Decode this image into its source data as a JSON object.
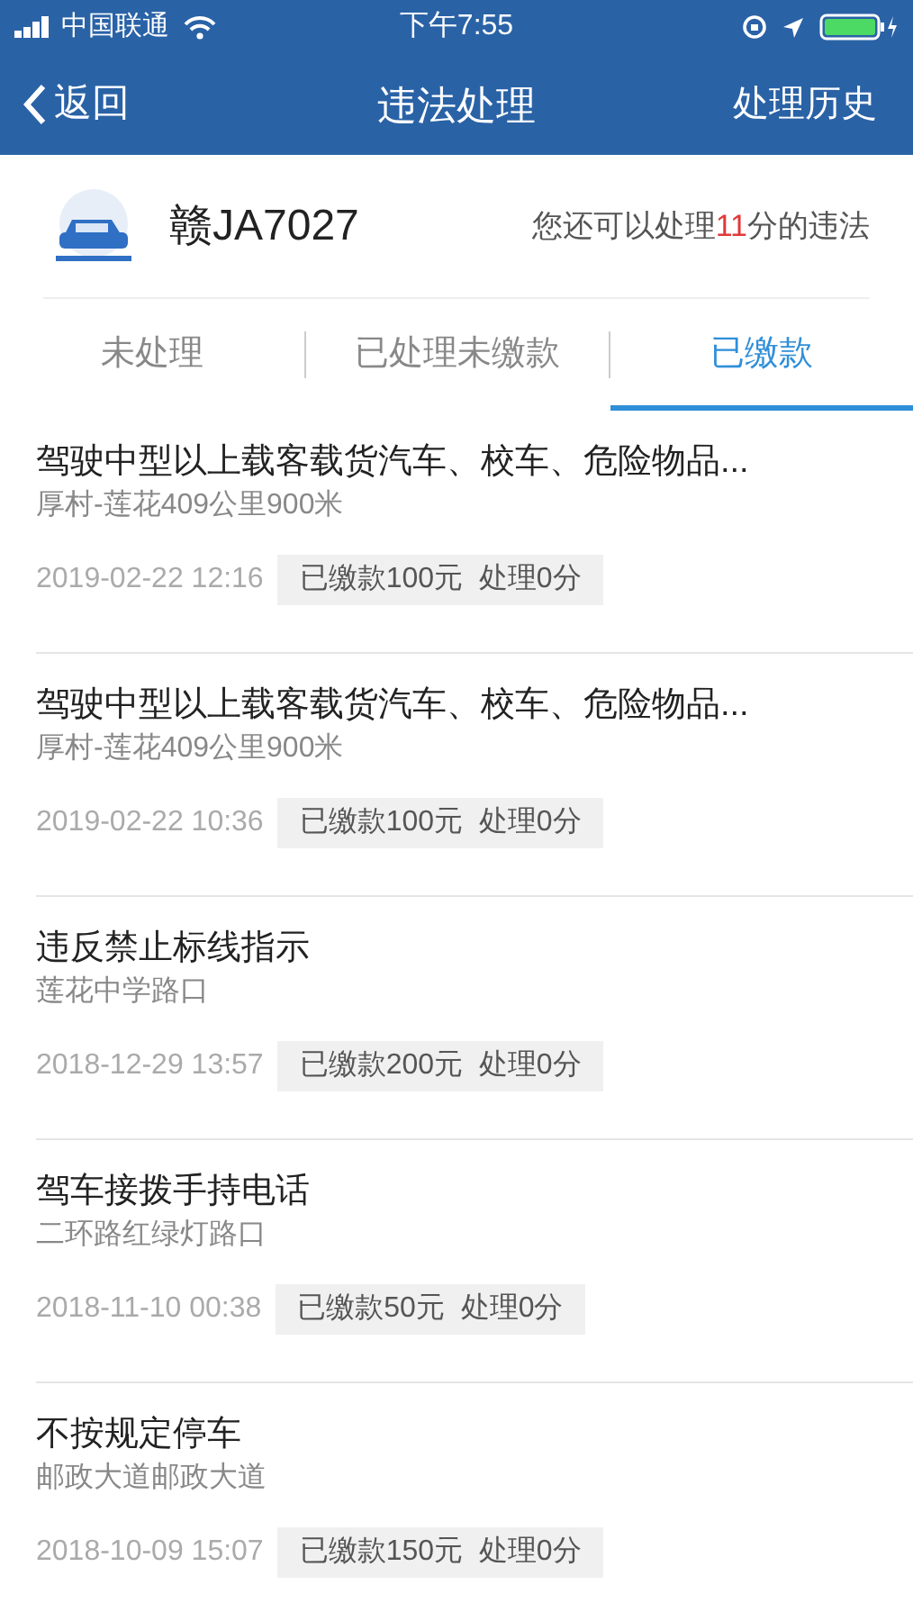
{
  "status_bar": {
    "carrier": "中国联通",
    "time": "下午7:55"
  },
  "nav": {
    "back": "返回",
    "title": "违法处理",
    "action": "处理历史"
  },
  "vehicle": {
    "plate": "赣JA7027",
    "points_prefix": "您还可以处理",
    "points": "11",
    "points_suffix": "分的违法"
  },
  "tabs": [
    {
      "label": "未处理",
      "selected": false
    },
    {
      "label": "已处理未缴款",
      "selected": false
    },
    {
      "label": "已缴款",
      "selected": true
    }
  ],
  "violations": [
    {
      "title": "驾驶中型以上载客载货汽车、校车、危险物品...",
      "location": "厚村-莲花409公里900米",
      "time": "2019-02-22 12:16",
      "tag": "已缴款100元  处理0分"
    },
    {
      "title": "驾驶中型以上载客载货汽车、校车、危险物品...",
      "location": "厚村-莲花409公里900米",
      "time": "2019-02-22 10:36",
      "tag": "已缴款100元  处理0分"
    },
    {
      "title": "违反禁止标线指示",
      "location": "莲花中学路口",
      "time": "2018-12-29 13:57",
      "tag": "已缴款200元  处理0分"
    },
    {
      "title": "驾车接拨手持电话",
      "location": "二环路红绿灯路口",
      "time": "2018-11-10 00:38",
      "tag": "已缴款50元  处理0分"
    },
    {
      "title": "不按规定停车",
      "location": "邮政大道邮政大道",
      "time": "2018-10-09 15:07",
      "tag": "已缴款150元  处理0分"
    }
  ]
}
